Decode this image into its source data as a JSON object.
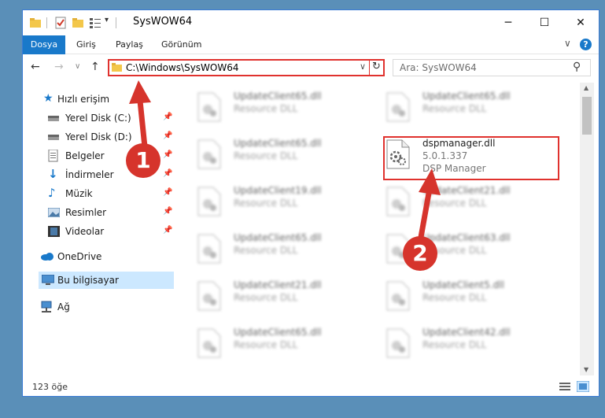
{
  "window": {
    "title": "SysWOW64",
    "controls": {
      "minimize": "─",
      "maximize": "☐",
      "close": "✕"
    }
  },
  "ribbon": {
    "tabs": [
      "Dosya",
      "Giriş",
      "Paylaş",
      "Görünüm"
    ],
    "expand": "∨",
    "help": "?"
  },
  "navigation": {
    "back": "←",
    "forward": "→",
    "recent": "∨",
    "up": "↑",
    "address": "C:\\Windows\\SysWOW64",
    "address_dropdown": "∨",
    "refresh": "↻",
    "search_placeholder": "Ara: SysWOW64",
    "search_icon": "⚲"
  },
  "sidebar": {
    "items": [
      {
        "label": "Hızlı erişim",
        "icon": "star-icon",
        "pinned": false
      },
      {
        "label": "Yerel Disk (C:)",
        "icon": "drive-icon",
        "pinned": true
      },
      {
        "label": "Yerel Disk (D:)",
        "icon": "drive-icon",
        "pinned": true
      },
      {
        "label": "Belgeler",
        "icon": "documents-icon",
        "pinned": true
      },
      {
        "label": "İndirmeler",
        "icon": "downloads-icon",
        "pinned": true
      },
      {
        "label": "Müzik",
        "icon": "music-icon",
        "pinned": true
      },
      {
        "label": "Resimler",
        "icon": "pictures-icon",
        "pinned": true
      },
      {
        "label": "Videolar",
        "icon": "videos-icon",
        "pinned": true
      },
      {
        "label": "OneDrive",
        "icon": "cloud-icon",
        "pinned": false
      },
      {
        "label": "Bu bilgisayar",
        "icon": "computer-icon",
        "pinned": false
      },
      {
        "label": "Ağ",
        "icon": "network-icon",
        "pinned": false
      }
    ],
    "pin_glyph": "📌"
  },
  "files": [
    {
      "name": "UpdateClient65.dll",
      "type": "Resource DLL"
    },
    {
      "name": "UpdateClient65.dll",
      "type": "Resource DLL"
    },
    {
      "name": "UpdateClient65.dll",
      "type": "Resource DLL"
    },
    {
      "name": "dspmanager.dll",
      "version": "5.0.1.337",
      "type": "DSP Manager"
    },
    {
      "name": "UpdateClient19.dll",
      "type": "Resource DLL"
    },
    {
      "name": "UpdateClient21.dll",
      "type": "Resource DLL"
    },
    {
      "name": "UpdateClient65.dll",
      "type": "Resource DLL"
    },
    {
      "name": "UpdateClient63.dll",
      "type": "Resource DLL"
    },
    {
      "name": "UpdateClient21.dll",
      "type": "Resource DLL"
    },
    {
      "name": "UpdateClient5.dll",
      "type": "Resource DLL"
    },
    {
      "name": "UpdateClient65.dll",
      "type": "Resource DLL"
    },
    {
      "name": "UpdateClient42.dll",
      "type": "Resource DLL"
    }
  ],
  "status": {
    "count": "123 öğe"
  },
  "callouts": [
    "1",
    "2"
  ],
  "colors": {
    "accent": "#1979ca",
    "highlight": "#e0322e",
    "selection": "#cce8ff"
  }
}
